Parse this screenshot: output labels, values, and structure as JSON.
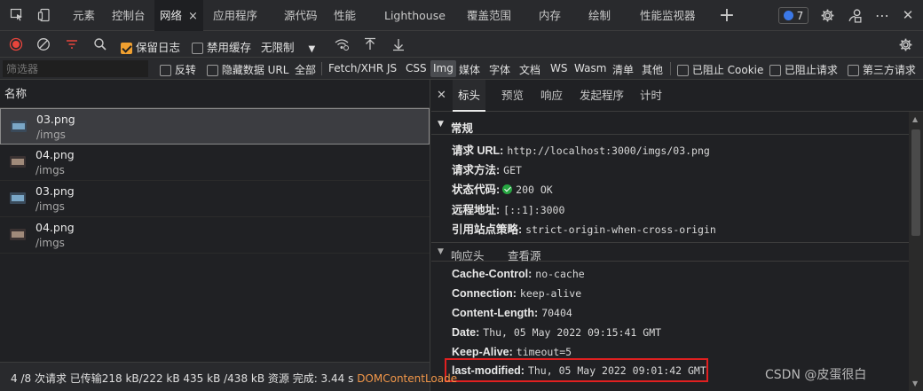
{
  "tabbar": {
    "tabs": [
      "元素",
      "控制台",
      "网络",
      "应用程序",
      "源代码",
      "性能",
      "Lighthouse",
      "覆盖范围",
      "内存",
      "绘制",
      "性能监视器"
    ],
    "active_tab_close": "×",
    "add_tab": "+",
    "issues_count": "7",
    "more": "⋯",
    "close": "✕"
  },
  "toolbar": {
    "preserve_log": "保留日志",
    "preserve_log_checked": true,
    "disable_cache": "禁用缓存",
    "disable_cache_checked": false,
    "throttling": "无限制"
  },
  "filterbar": {
    "placeholder": "筛选器",
    "invert": "反转",
    "hide_data_urls": "隐藏数据 URL",
    "types": [
      "全部",
      "Fetch/XHR",
      "JS",
      "CSS",
      "Img",
      "媒体",
      "字体",
      "文档",
      "WS",
      "Wasm",
      "清单",
      "其他"
    ],
    "selected_type": "Img",
    "blocked_cookies": "已阻止 Cookie",
    "blocked_requests": "已阻止请求",
    "third_party": "第三方请求"
  },
  "requests": {
    "header": "名称",
    "rows": [
      {
        "name": "03.png",
        "path": "/imgs",
        "selected": true
      },
      {
        "name": "04.png",
        "path": "/imgs",
        "selected": false
      },
      {
        "name": "03.png",
        "path": "/imgs",
        "selected": false
      },
      {
        "name": "04.png",
        "path": "/imgs",
        "selected": false
      }
    ]
  },
  "details": {
    "close": "✕",
    "tabs": [
      "标头",
      "预览",
      "响应",
      "发起程序",
      "计时"
    ],
    "active_tab": "标头",
    "general": {
      "title": "常规",
      "rows": [
        {
          "key": "请求 URL:",
          "value": "http://localhost:3000/imgs/03.png"
        },
        {
          "key": "请求方法:",
          "value": "GET"
        },
        {
          "key": "状态代码:",
          "value": "200 OK"
        },
        {
          "key": "远程地址:",
          "value": "[::1]:3000"
        },
        {
          "key": "引用站点策略:",
          "value": "strict-origin-when-cross-origin"
        }
      ]
    },
    "response_headers": {
      "title": "响应头",
      "view_source": "查看源",
      "rows": [
        {
          "key": "Cache-Control:",
          "value": "no-cache"
        },
        {
          "key": "Connection:",
          "value": "keep-alive"
        },
        {
          "key": "Content-Length:",
          "value": "70404"
        },
        {
          "key": "Date:",
          "value": "Thu, 05 May 2022 09:15:41 GMT"
        },
        {
          "key": "Keep-Alive:",
          "value": "timeout=5"
        },
        {
          "key": "last-modified:",
          "value": "Thu, 05 May 2022 09:01:42 GMT"
        }
      ]
    }
  },
  "status": {
    "summary": "4 /8 次请求  已传输218 kB/222 kB  435 kB /438 kB 资源  完成: 3.44 s",
    "dcl": "DOMContentLoade"
  },
  "watermark": "CSDN @皮蛋很白",
  "colors": {
    "accent_checkbox": "#f0a030",
    "record_red": "#e8453c",
    "ok_green": "#26a641",
    "highlight_red": "#e02020",
    "dcl_orange": "#f29749"
  }
}
